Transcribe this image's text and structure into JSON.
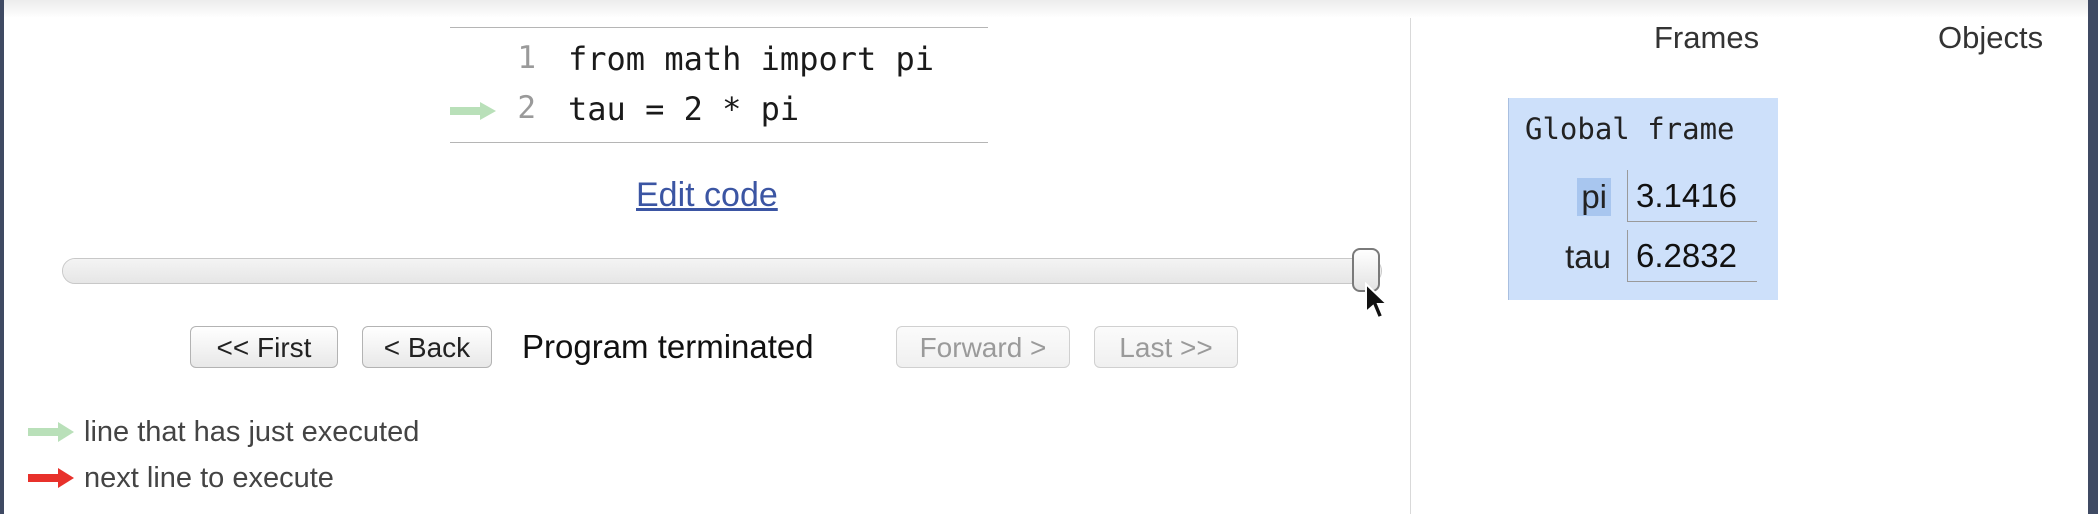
{
  "code": {
    "lines": [
      {
        "number": "1",
        "text": "from math import pi"
      },
      {
        "number": "2",
        "text": "tau = 2 * pi"
      }
    ],
    "current_line_number": "2",
    "edit_link_label": "Edit code"
  },
  "slider": {
    "position_fraction": 1.0
  },
  "navigation": {
    "first_label": "<< First",
    "back_label": "< Back",
    "status": "Program terminated",
    "forward_label": "Forward >",
    "last_label": "Last >>"
  },
  "legend": {
    "executed_text": "line that has just executed",
    "next_text": "next line to execute",
    "executed_color": "#b9e0b9",
    "next_color": "#e8312b"
  },
  "visualizer": {
    "frames_header": "Frames",
    "objects_header": "Objects",
    "global_frame": {
      "title": "Global frame",
      "variables": [
        {
          "name": "pi",
          "value": "3.1416"
        },
        {
          "name": "tau",
          "value": "6.2832"
        }
      ]
    },
    "frame_color": "#cde0fa"
  }
}
